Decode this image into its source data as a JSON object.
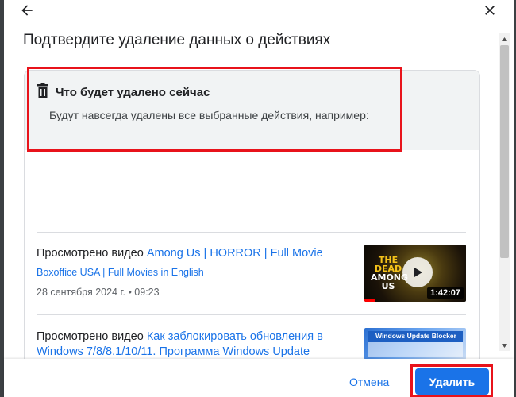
{
  "dialog": {
    "title": "Подтвердите удаление данных о действиях"
  },
  "summary": {
    "heading": "Что будет удалено сейчас",
    "description": "Будут навсегда удалены все выбранные действия, например:"
  },
  "activities": [
    {
      "prefix": "Просмотрено видео ",
      "video_title": "Among Us | HORROR | Full Movie",
      "channel": "Boxoffice USA | Full Movies in English",
      "date": "28 сентября 2024 г. • 09:23",
      "thumbnail": {
        "text_line1": "THE",
        "text_line2": "DEAD",
        "text_line3": "AMONG",
        "text_line4": "US",
        "duration": "1:42:07"
      }
    },
    {
      "prefix": "Просмотрено видео ",
      "video_title_line1": "Как заблокировать обновления в",
      "video_title_line2": "Windows 7/8/8.1/10/11. Программа Windows Update",
      "thumbnail": {
        "title": "Windows Update Blocker"
      }
    }
  ],
  "actions": {
    "cancel_label": "Отмена",
    "delete_label": "Удалить"
  },
  "colors": {
    "accent": "#1a73e8",
    "highlight": "#e8131b",
    "panel_bg": "#f1f3f4"
  },
  "icons": {
    "back": "arrow-back-icon",
    "close": "close-icon",
    "trash": "trash-icon",
    "play": "play-icon"
  }
}
